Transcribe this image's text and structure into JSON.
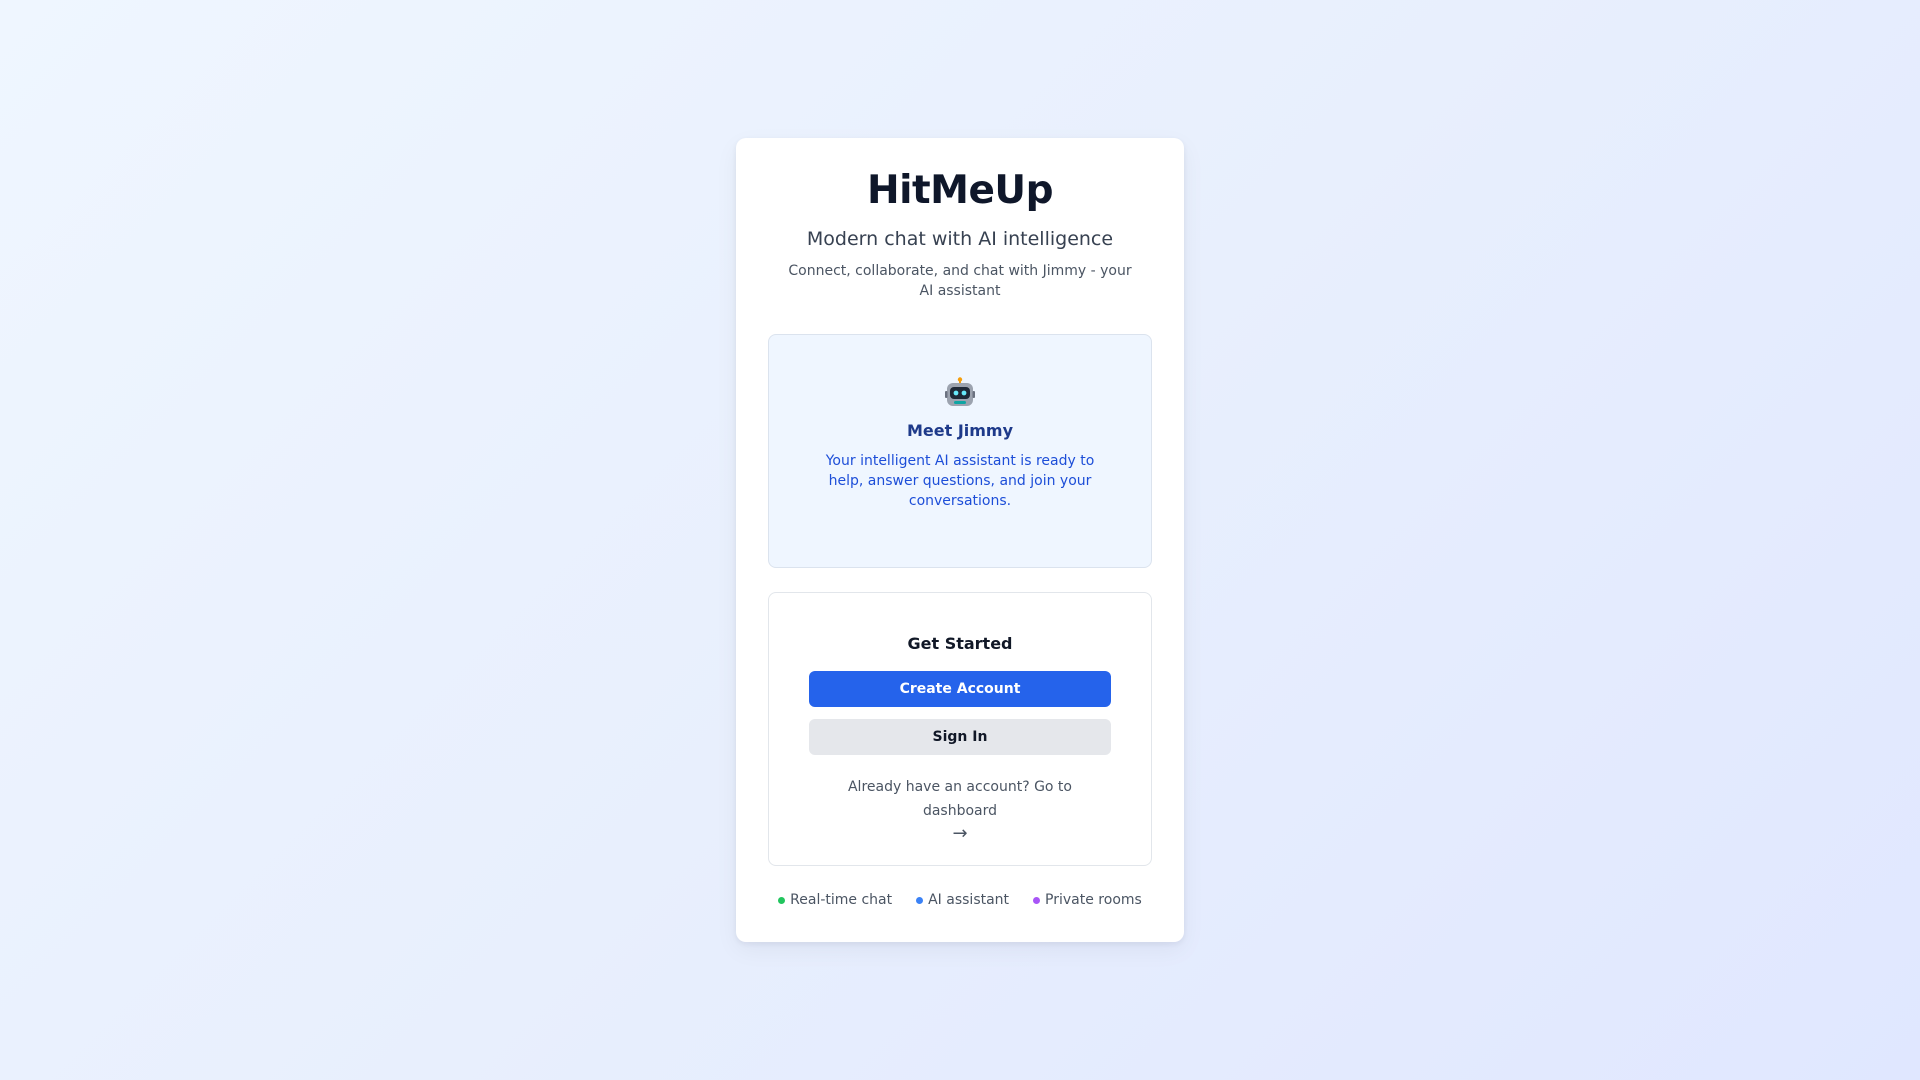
{
  "app": {
    "title": "HitMeUp",
    "tagline": "Modern chat with AI intelligence",
    "description": "Connect, collaborate, and chat with Jimmy - your AI assistant"
  },
  "assistant": {
    "icon": "robot-icon",
    "title": "Meet Jimmy",
    "text": "Your intelligent AI assistant is ready to help, answer questions, and join your conversations."
  },
  "get_started": {
    "title": "Get Started",
    "create_account_label": "Create Account",
    "sign_in_label": "Sign In",
    "dashboard_text": "Already have an account? Go to dashboard",
    "dashboard_arrow": "→"
  },
  "features": [
    {
      "label": "Real-time chat",
      "color": "#22c55e"
    },
    {
      "label": "AI assistant",
      "color": "#3b82f6"
    },
    {
      "label": "Private rooms",
      "color": "#a855f7"
    }
  ],
  "colors": {
    "primary": "#2563eb",
    "secondary_button": "#e5e7eb",
    "panel_bg": "#eff6ff"
  }
}
